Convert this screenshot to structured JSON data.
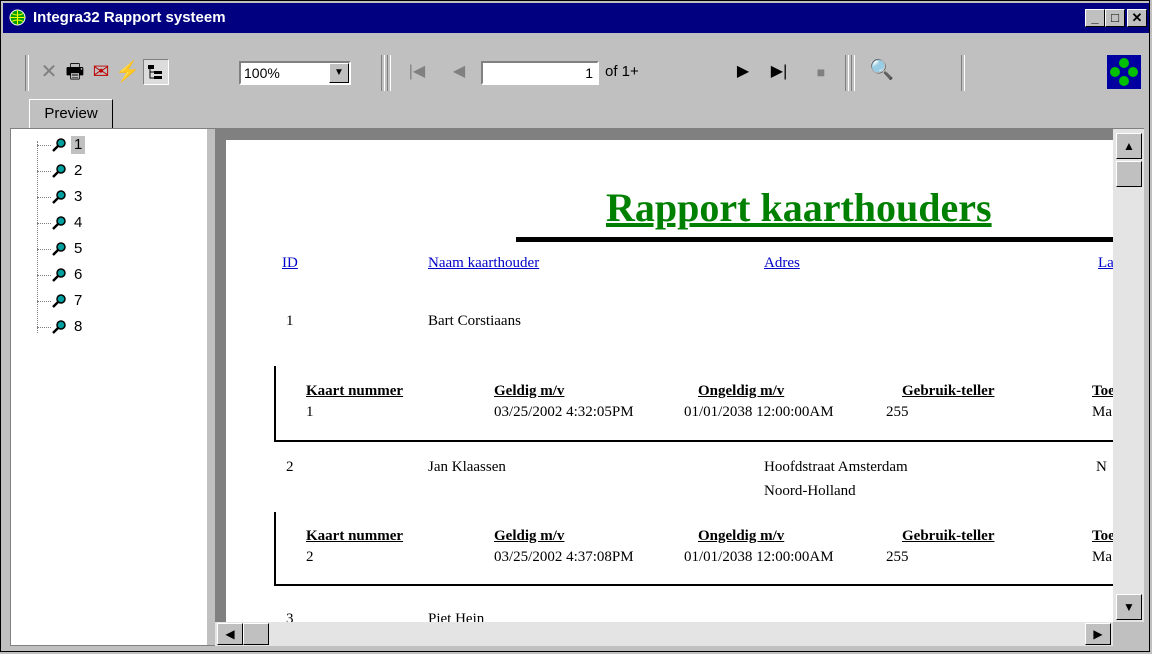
{
  "window": {
    "title": "Integra32 Rapport systeem"
  },
  "toolbar": {
    "zoom_value": "100%",
    "page_value": "1",
    "page_of": "of 1+"
  },
  "tab": {
    "label": "Preview"
  },
  "tree": {
    "items": [
      "1",
      "2",
      "3",
      "4",
      "5",
      "6",
      "7",
      "8"
    ]
  },
  "report": {
    "title": "Rapport kaarthouders",
    "columns": {
      "id": "ID",
      "name": "Naam kaarthouder",
      "address": "Adres",
      "last": "La"
    },
    "sub_columns": {
      "card": "Kaart nummer",
      "valid_from": "Geldig m/v",
      "invalid_from": "Ongeldig m/v",
      "counter": "Gebruik-teller",
      "access": "Toe"
    },
    "rows": [
      {
        "id": "1",
        "name": "Bart Corstiaans",
        "address1": "",
        "address2": "",
        "last": "",
        "card": "1",
        "valid_from": "03/25/2002  4:32:05PM",
        "invalid_from": "01/01/2038  12:00:00AM",
        "counter": "255",
        "access": "Ma"
      },
      {
        "id": "2",
        "name": "Jan Klaassen",
        "address1": "Hoofdstraat Amsterdam",
        "address2": "Noord-Holland",
        "last": "N",
        "card": "2",
        "valid_from": "03/25/2002  4:37:08PM",
        "invalid_from": "01/01/2038  12:00:00AM",
        "counter": "255",
        "access": "Ma"
      },
      {
        "id": "3",
        "name": "Piet Hein"
      }
    ]
  },
  "colors": {
    "title_bar": "#000080",
    "report_title": "#008000",
    "header_link": "#0000c8"
  }
}
